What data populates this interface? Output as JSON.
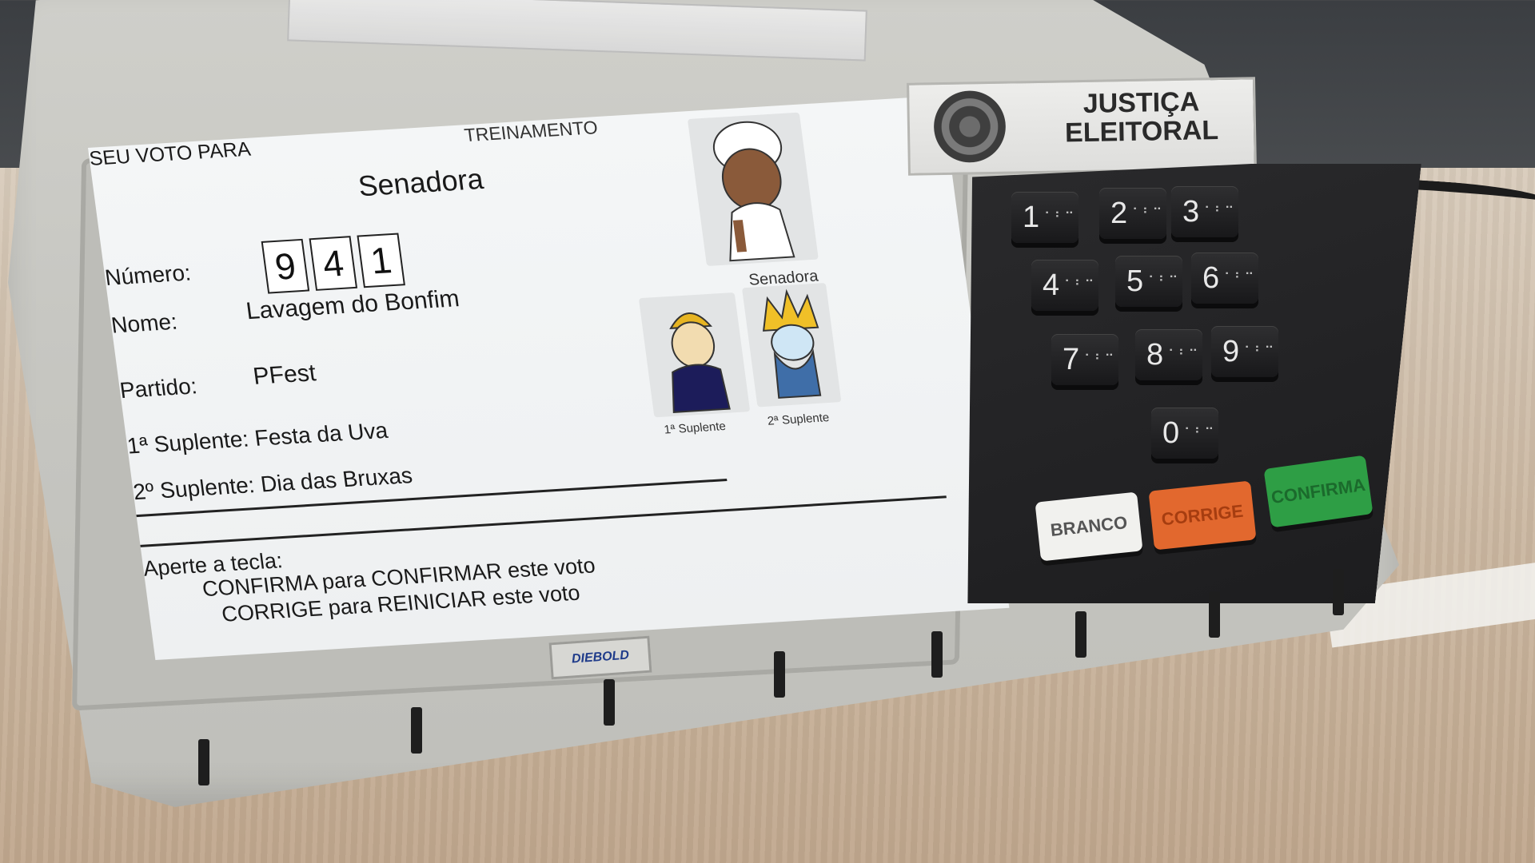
{
  "screen": {
    "header_left": "SEU VOTO PARA",
    "header_center": "TREINAMENTO",
    "office": "Senadora",
    "numero_label": "Número:",
    "digits": [
      "9",
      "4",
      "1"
    ],
    "nome_label": "Nome:",
    "nome_value": "Lavagem do Bonfim",
    "partido_label": "Partido:",
    "partido_value": "PFest",
    "suplente1": "1ª Suplente: Festa da Uva",
    "suplente2": "2º Suplente: Dia das Bruxas",
    "caption_main": "Senadora",
    "caption_sup1": "1ª Suplente",
    "caption_sup2": "2ª Suplente",
    "instructions_title": "Aperte a tecla:",
    "instruction_confirm": "CONFIRMA para CONFIRMAR este voto",
    "instruction_correct": "CORRIGE para REINICIAR este voto"
  },
  "brand": "DIEBOLD",
  "header_plate": {
    "line1": "JUSTIÇA",
    "line2": "ELEITORAL"
  },
  "keypad": {
    "keys": [
      "1",
      "2",
      "3",
      "4",
      "5",
      "6",
      "7",
      "8",
      "9",
      "0"
    ],
    "braille": "⠁⠃⠉",
    "branco": "BRANCO",
    "corrige": "CORRIGE",
    "confirma": "CONFIRMA"
  },
  "colors": {
    "branco": "#f1f1ee",
    "corrige": "#e2682e",
    "confirma": "#2e9e45"
  }
}
